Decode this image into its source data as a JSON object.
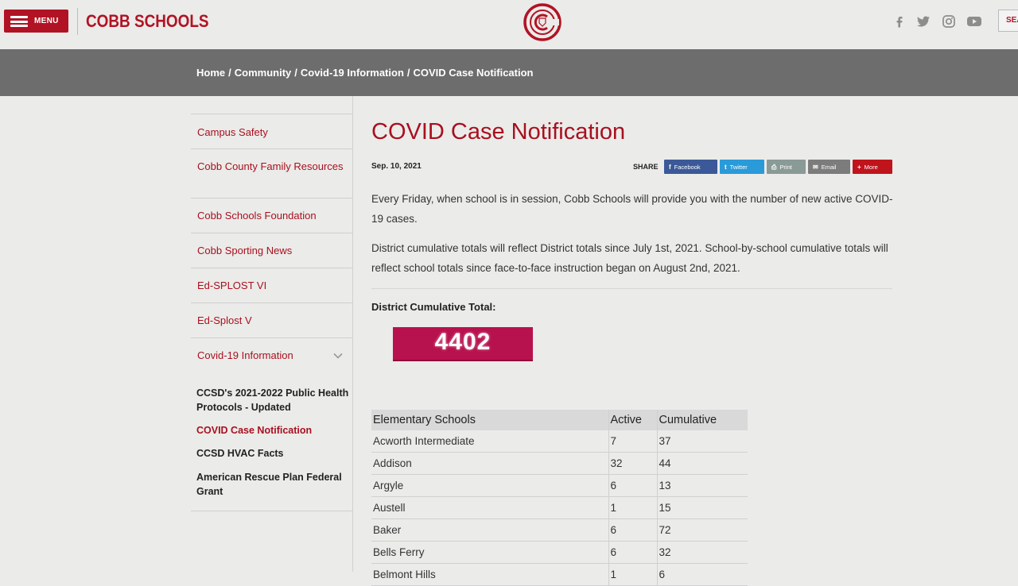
{
  "header": {
    "menu_label": "MENU",
    "brand": "COBB SCHOOLS",
    "search_label": "SEA",
    "social_icons": [
      "facebook-icon",
      "twitter-icon",
      "instagram-icon",
      "youtube-icon"
    ]
  },
  "breadcrumb": [
    "Home",
    "Community",
    "Covid-19 Information",
    "COVID Case Notification"
  ],
  "sidebar": {
    "items": [
      {
        "label": "Campus Safety"
      },
      {
        "label": "Cobb County Family Resources"
      },
      {
        "label": "Cobb Schools Foundation"
      },
      {
        "label": "Cobb Sporting News"
      },
      {
        "label": "Ed-SPLOST VI"
      },
      {
        "label": "Ed-Splost V"
      },
      {
        "label": "Covid-19 Information"
      }
    ],
    "subitems": [
      {
        "label": "CCSD's 2021-2022 Public Health Protocols - Updated"
      },
      {
        "label": "COVID Case Notification"
      },
      {
        "label": "CCSD HVAC Facts"
      },
      {
        "label": "American Rescue Plan Federal Grant"
      }
    ]
  },
  "main": {
    "title": "COVID Case Notification",
    "date": "Sep. 10, 2021",
    "share_label": "SHARE",
    "share_buttons": [
      {
        "label": "Facebook",
        "icon": "f"
      },
      {
        "label": "Twitter",
        "icon": "t"
      },
      {
        "label": "Print",
        "icon": "⎙"
      },
      {
        "label": "Email",
        "icon": "✉"
      },
      {
        "label": "More",
        "icon": "+"
      }
    ],
    "paragraph1": "Every Friday, when school is in session, Cobb Schools will provide you with the number of new active COVID-19 cases.",
    "paragraph2": "District cumulative totals will reflect District totals since July 1st, 2021. School-by-school cumulative totals will reflect school totals since face-to-face instruction began on August 2nd, 2021.",
    "district_label": "District Cumulative Total:",
    "district_total": "4402"
  },
  "table": {
    "headers": [
      "Elementary Schools",
      "Active",
      "Cumulative"
    ],
    "rows": [
      [
        "Acworth Intermediate",
        "7",
        "37"
      ],
      [
        "Addison",
        "32",
        "44"
      ],
      [
        "Argyle",
        "6",
        "13"
      ],
      [
        "Austell",
        "1",
        "15"
      ],
      [
        "Baker",
        "6",
        "72"
      ],
      [
        "Bells Ferry",
        "6",
        "32"
      ],
      [
        "Belmont Hills",
        "1",
        "6"
      ]
    ]
  },
  "colors": {
    "brand_red": "#b11324",
    "link_red": "#a8101f",
    "counter_bg": "#b8124e",
    "breadcrumb_bg": "#6d6d6d"
  }
}
